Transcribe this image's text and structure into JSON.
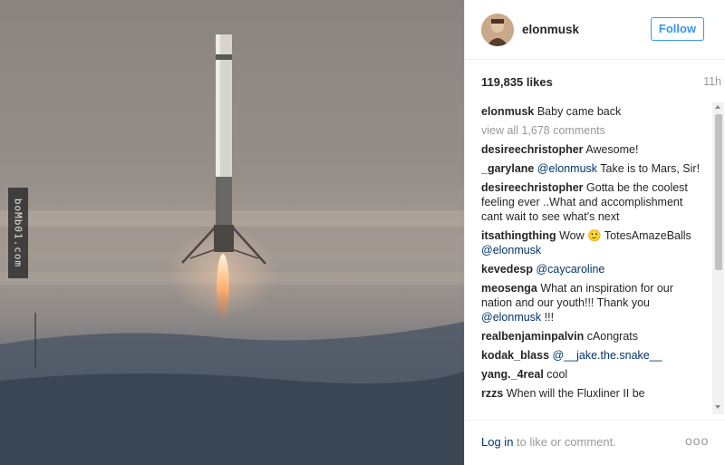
{
  "post": {
    "username": "elonmusk",
    "follow_label": "Follow",
    "likes": "119,835 likes",
    "time": "11h"
  },
  "photo": {
    "watermark": "boMb01.com"
  },
  "comments": [
    {
      "user": "elonmusk",
      "parts": [
        {
          "t": " Baby came back"
        }
      ]
    },
    {
      "user": "desireechristopher",
      "parts": [
        {
          "t": " Awesome!"
        }
      ]
    },
    {
      "user": "_garylane",
      "parts": [
        {
          "t": " "
        },
        {
          "m": "@elonmusk"
        },
        {
          "t": " Take is to Mars, Sir!"
        }
      ]
    },
    {
      "user": "desireechristopher",
      "parts": [
        {
          "t": " Gotta be the coolest feeling ever ..What and accomplishment cant wait to see what's next"
        }
      ]
    },
    {
      "user": "itsathingthing",
      "parts": [
        {
          "t": " Wow 🙂 TotesAmazeBalls "
        },
        {
          "m": "@elonmusk"
        }
      ]
    },
    {
      "user": "kevedesp",
      "parts": [
        {
          "t": " "
        },
        {
          "m": "@caycaroline"
        }
      ]
    },
    {
      "user": "meosenga",
      "parts": [
        {
          "t": " What an inspiration for our nation and our youth!!! Thank you "
        },
        {
          "m": "@elonmusk"
        },
        {
          "t": " !!!"
        }
      ]
    },
    {
      "user": "realbenjaminpalvin",
      "parts": [
        {
          "t": " cAongrats"
        }
      ]
    },
    {
      "user": "kodak_blass",
      "parts": [
        {
          "t": " "
        },
        {
          "m": "@__jake.the.snake__"
        }
      ]
    },
    {
      "user": "yang._4real",
      "parts": [
        {
          "t": " cool"
        }
      ]
    },
    {
      "user": "rzzs",
      "parts": [
        {
          "t": " When will the Fluxliner II be"
        }
      ]
    }
  ],
  "view_all_label": "view all 1,678 comments",
  "footer": {
    "login_link": "Log in",
    "login_rest": " to like or comment.",
    "more_label": "ooo"
  },
  "icons": [
    "more-options-icon",
    "scroll-up-arrow-icon",
    "scroll-down-arrow-icon"
  ]
}
